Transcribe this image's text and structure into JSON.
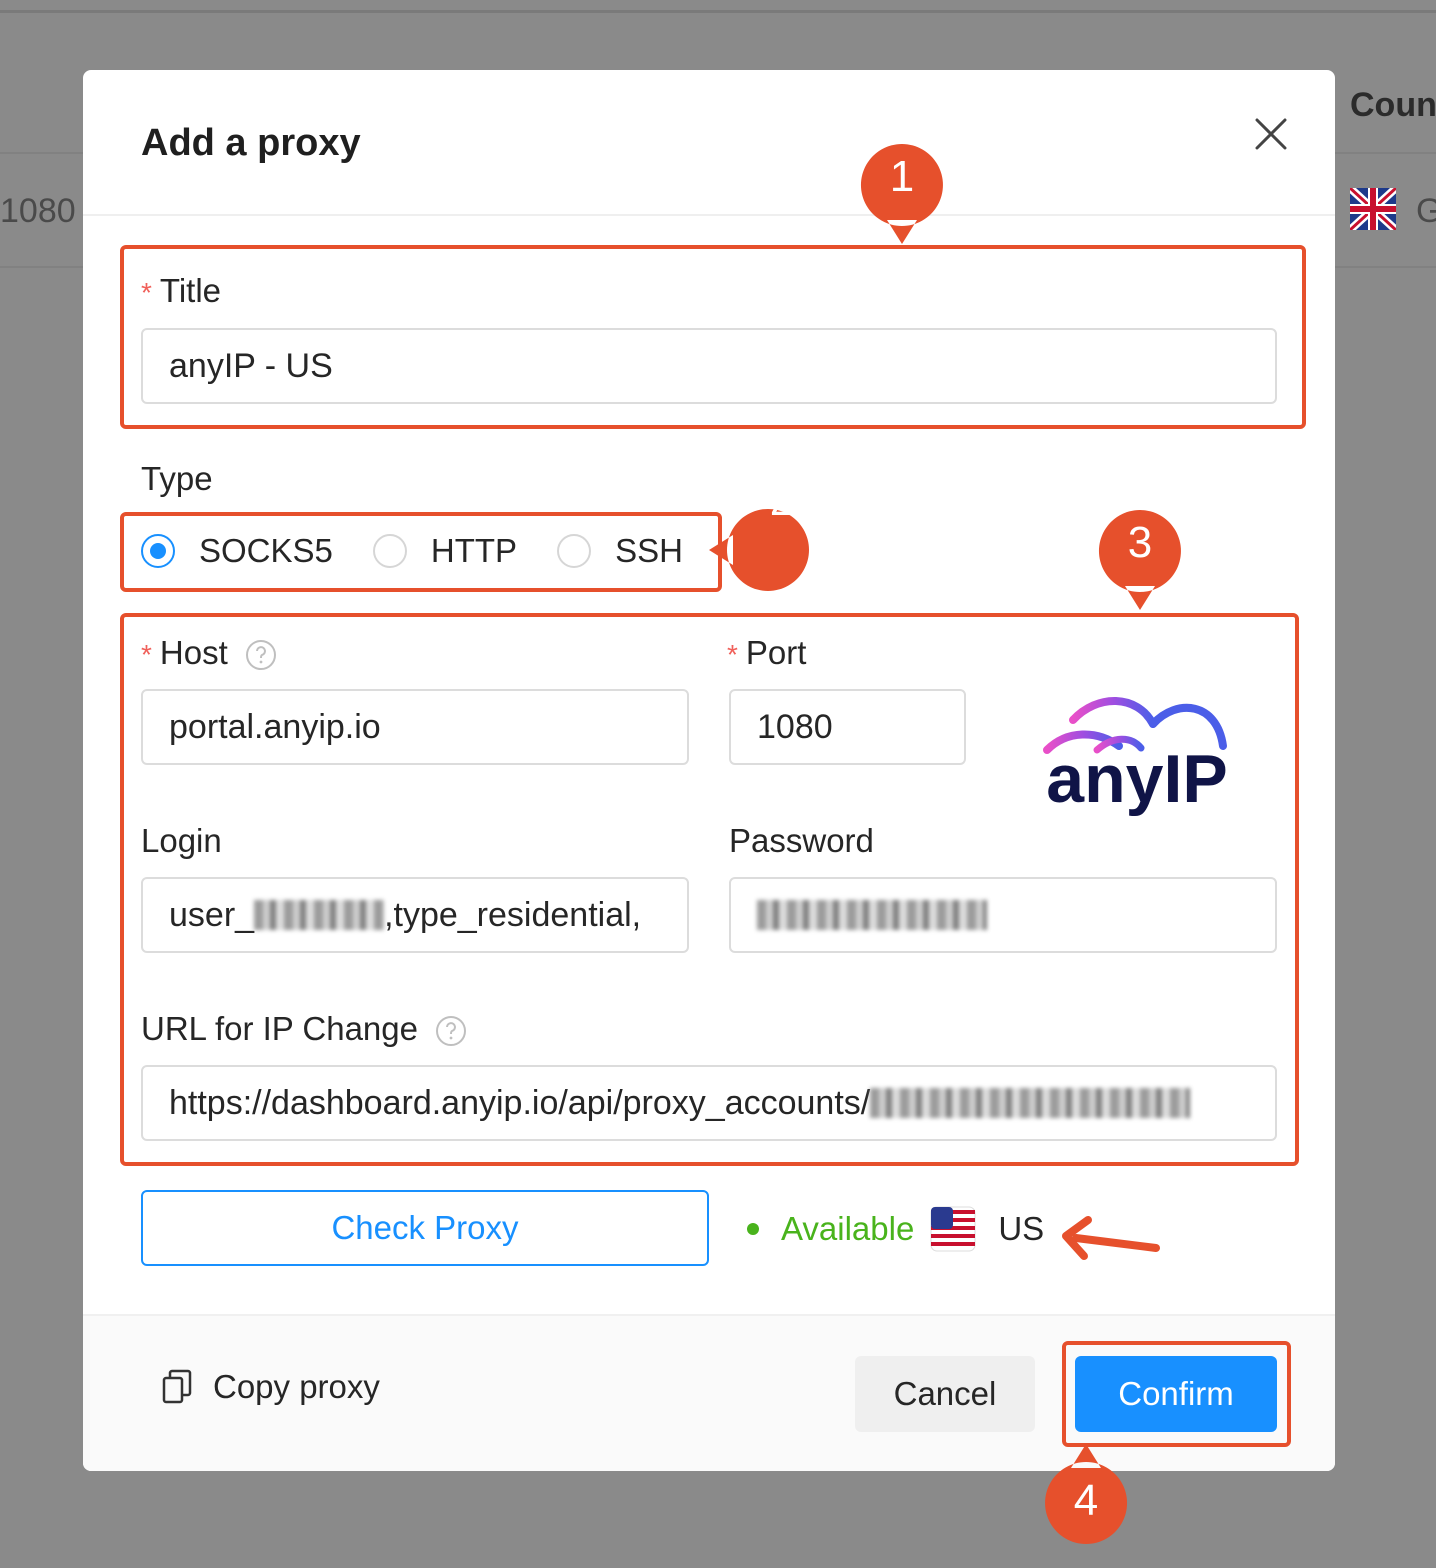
{
  "background": {
    "column_header_partial": "Coun",
    "port_value_partial": "1080",
    "country_partial": "G",
    "flag_icon": "uk-flag-icon"
  },
  "modal": {
    "title": "Add a proxy",
    "close_icon": "close-icon",
    "title_field": {
      "label": "Title",
      "value": "anyIP - US"
    },
    "type": {
      "label": "Type",
      "options": [
        "SOCKS5",
        "HTTP",
        "SSH"
      ],
      "selected": "SOCKS5"
    },
    "host": {
      "label": "Host",
      "value": "portal.anyip.io"
    },
    "port": {
      "label": "Port",
      "value": "1080"
    },
    "login": {
      "label": "Login",
      "value_prefix": "user_",
      "value_suffix": ",type_residential,"
    },
    "password": {
      "label": "Password"
    },
    "url_ip_change": {
      "label": "URL for IP Change",
      "value_prefix": "https://dashboard.anyip.io/api/proxy_accounts/"
    },
    "logo_text": "anyIP",
    "check_button": "Check Proxy",
    "status": {
      "text": "Available",
      "country": "US",
      "color": "#49b31c"
    },
    "footer": {
      "copy_label": "Copy proxy",
      "cancel": "Cancel",
      "confirm": "Confirm"
    }
  },
  "annotations": [
    "1",
    "2",
    "3",
    "4"
  ],
  "colors": {
    "accent": "#1890ff",
    "annotation": "#e6502c",
    "required": "#f0605a"
  }
}
